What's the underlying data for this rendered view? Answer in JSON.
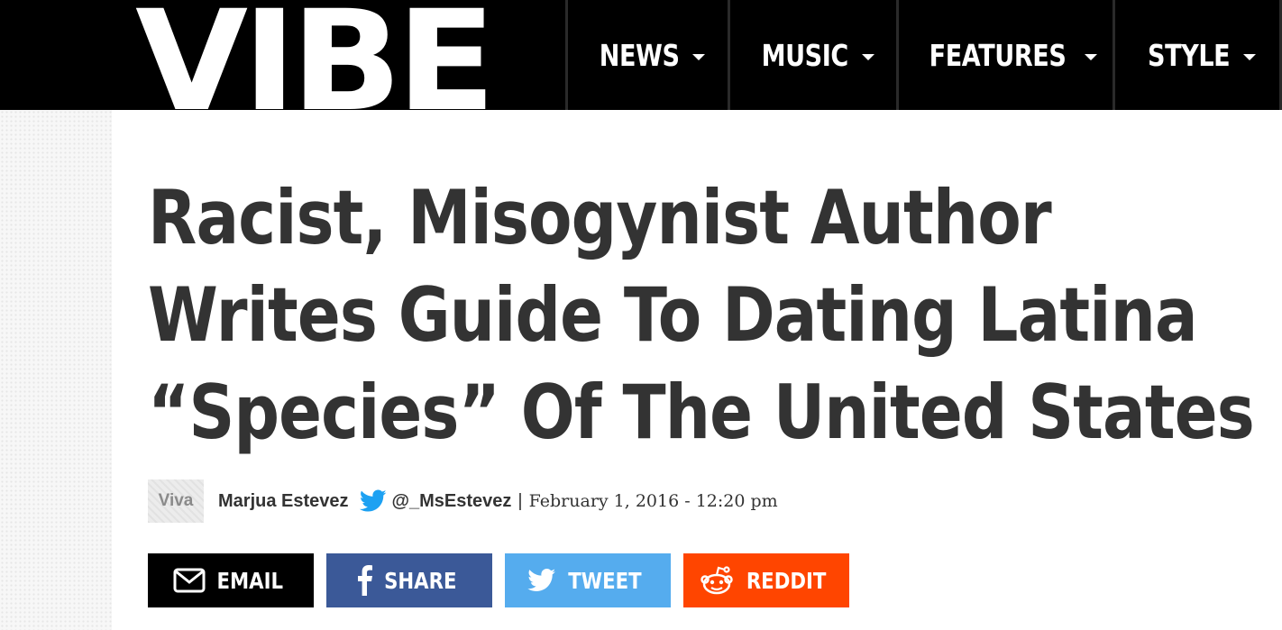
{
  "header": {
    "logo_text": "VIBE",
    "nav": [
      {
        "label": "NEWS"
      },
      {
        "label": "MUSIC"
      },
      {
        "label": "FEATURES"
      },
      {
        "label": "STYLE"
      }
    ]
  },
  "article": {
    "title_lines": [
      "Racist, Misogynist Author",
      "Writes Guide To Dating Latina",
      "“Species” Of The United States"
    ],
    "category": "Viva",
    "author": "Marjua Estevez",
    "twitter_handle": "@_MsEstevez",
    "separator": "|",
    "date": "February 1, 2016 - 12:20 pm"
  },
  "share_buttons": {
    "email": {
      "label": "EMAIL",
      "icon": "envelope-icon",
      "color": "#000000"
    },
    "facebook": {
      "label": "SHARE",
      "icon": "facebook-icon",
      "color": "#3b5998"
    },
    "twitter": {
      "label": "TWEET",
      "icon": "twitter-icon",
      "color": "#55acee"
    },
    "reddit": {
      "label": "REDDIT",
      "icon": "reddit-icon",
      "color": "#ff4500"
    }
  },
  "colors": {
    "header_bg": "#000000",
    "headline_text": "#333333",
    "twitter_blue": "#1da1f2"
  }
}
